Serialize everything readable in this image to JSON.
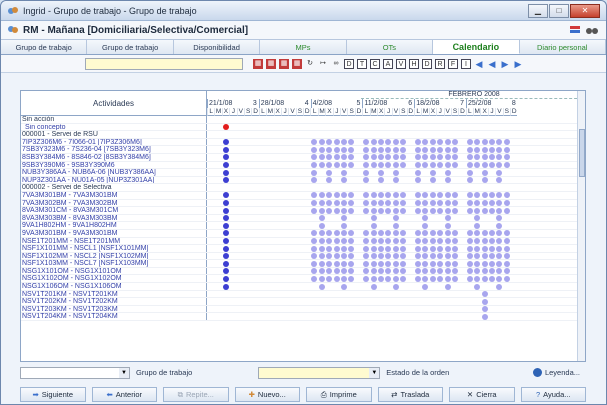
{
  "window": {
    "title": "Ingrid - Grupo de trabajo - Grupo de trabajo"
  },
  "header": {
    "title": "RM - Mañana [Domiciliaria/Selectiva/Comercial]"
  },
  "tabs": [
    {
      "label": "Grupo de trabajo",
      "active": false
    },
    {
      "label": "Grupo de trabajo",
      "active": false
    },
    {
      "label": "Disponibilidad",
      "active": false
    },
    {
      "label": "MPs",
      "active": false
    },
    {
      "label": "OTs",
      "active": false
    },
    {
      "label": "Calendario",
      "active": true
    },
    {
      "label": "Diario personal",
      "active": false
    }
  ],
  "grid": {
    "activities_header": "Actividades",
    "month": "FEBRERO 2008",
    "weeks": [
      {
        "date": "21/1/08",
        "num": "3"
      },
      {
        "date": "28/1/08",
        "num": "4"
      },
      {
        "date": "4/2/08",
        "num": "5"
      },
      {
        "date": "11/2/08",
        "num": "6"
      },
      {
        "date": "18/2/08",
        "num": "7"
      },
      {
        "date": "25/2/08",
        "num": "8"
      }
    ],
    "day_letters": [
      "L",
      "M",
      "X",
      "J",
      "V",
      "S",
      "D"
    ],
    "rows": [
      {
        "label": "Sin acción",
        "kind": "section",
        "pattern": "none"
      },
      {
        "label": "Sin concepto",
        "kind": "sub",
        "pattern": "red"
      },
      {
        "label": "000001 - Servei de RSU",
        "kind": "section",
        "pattern": "none"
      },
      {
        "label": "7IP3Z306M6 - 7I066-01 [7IP3Z306M6]",
        "kind": "item",
        "pattern": "full"
      },
      {
        "label": "7SB3Y323M6 - 7S236-04 [7SB3Y323M6]",
        "kind": "item",
        "pattern": "full"
      },
      {
        "label": "8SB3Y384M6 - 8S846-02 [8SB3Y384M6]",
        "kind": "item",
        "pattern": "full"
      },
      {
        "label": "9SB3Y390M6 - 9SB3Y390M6",
        "kind": "item",
        "pattern": "full"
      },
      {
        "label": "NUB3Y386AA - NUB6A-06 [NUB3Y386AA]",
        "kind": "item",
        "pattern": "partial"
      },
      {
        "label": "NUP3Z301AA - NU01A-05 [NUP3Z301AA]",
        "kind": "item",
        "pattern": "partial"
      },
      {
        "label": "000002 - Servei de Selectiva",
        "kind": "section",
        "pattern": "none"
      },
      {
        "label": "7VA3M301BM - 7VA3M301BM",
        "kind": "item",
        "pattern": "full"
      },
      {
        "label": "7VA3M302BM - 7VA3M302BM",
        "kind": "item",
        "pattern": "full"
      },
      {
        "label": "8VA3M301CM - 8VA3M301CM",
        "kind": "item",
        "pattern": "full"
      },
      {
        "label": "8VA3M303BM - 8VA3M303BM",
        "kind": "item",
        "pattern": "sparse"
      },
      {
        "label": "9VA1H802HM - 9VA1H802HM",
        "kind": "item",
        "pattern": "sparse"
      },
      {
        "label": "9VA3M301BM - 9VA3M301BM",
        "kind": "item",
        "pattern": "full"
      },
      {
        "label": "NSE1T201MM - NSE1T201MM",
        "kind": "item",
        "pattern": "full"
      },
      {
        "label": "NSF1X101MM - NSCL1 [NSF1X101MM]",
        "kind": "item",
        "pattern": "full"
      },
      {
        "label": "NSF1X102MM - NSCL2 [NSF1X102MM]",
        "kind": "item",
        "pattern": "full"
      },
      {
        "label": "NSF1X103MM - NSCL7 [NSF1X103MM]",
        "kind": "item",
        "pattern": "full"
      },
      {
        "label": "NSG1X101OM - NSG1X101OM",
        "kind": "item",
        "pattern": "full"
      },
      {
        "label": "NSG1X102OM - NSG1X102OM",
        "kind": "item",
        "pattern": "full"
      },
      {
        "label": "NSG1X106OM - NSG1X106OM",
        "kind": "item",
        "pattern": "sparse"
      },
      {
        "label": "NSV1T201KM - NSV1T201KM",
        "kind": "item",
        "pattern": "late"
      },
      {
        "label": "NSV1T202KM - NSV1T202KM",
        "kind": "item",
        "pattern": "late"
      },
      {
        "label": "NSV1T203KM - NSV1T203KM",
        "kind": "item",
        "pattern": "late"
      },
      {
        "label": "NSV1T204KM - NSV1T204KM",
        "kind": "item",
        "pattern": "late"
      }
    ]
  },
  "filters": {
    "group_label": "Grupo de trabajo",
    "status_label": "Estado de la orden",
    "legend_label": "Leyenda..."
  },
  "buttons": {
    "next": "Siguiente",
    "prev": "Anterior",
    "repeat": "Repite...",
    "new": "Nuevo...",
    "print": "Imprime",
    "move": "Traslada",
    "close": "Cierra",
    "help": "Ayuda..."
  },
  "toolbar_icons": [
    "calendar-day-icon",
    "calendar-week-icon",
    "calendar-month-icon",
    "calendar-year-icon",
    "refresh-icon",
    "range-icon",
    "binoculars-icon",
    "d-icon",
    "t-icon",
    "c-icon",
    "a-icon",
    "v-icon",
    "h-icon",
    "d2-icon",
    "r-icon",
    "f-icon",
    "i-icon",
    "arrow-first-icon",
    "arrow-prev-icon",
    "arrow-next-icon",
    "arrow-last-icon"
  ],
  "colors": {
    "dot_light": "#a8a6ee",
    "dot_dark": "#3d3fd2",
    "dot_red": "#e21d1d",
    "accent_green": "#1d7f1d"
  }
}
